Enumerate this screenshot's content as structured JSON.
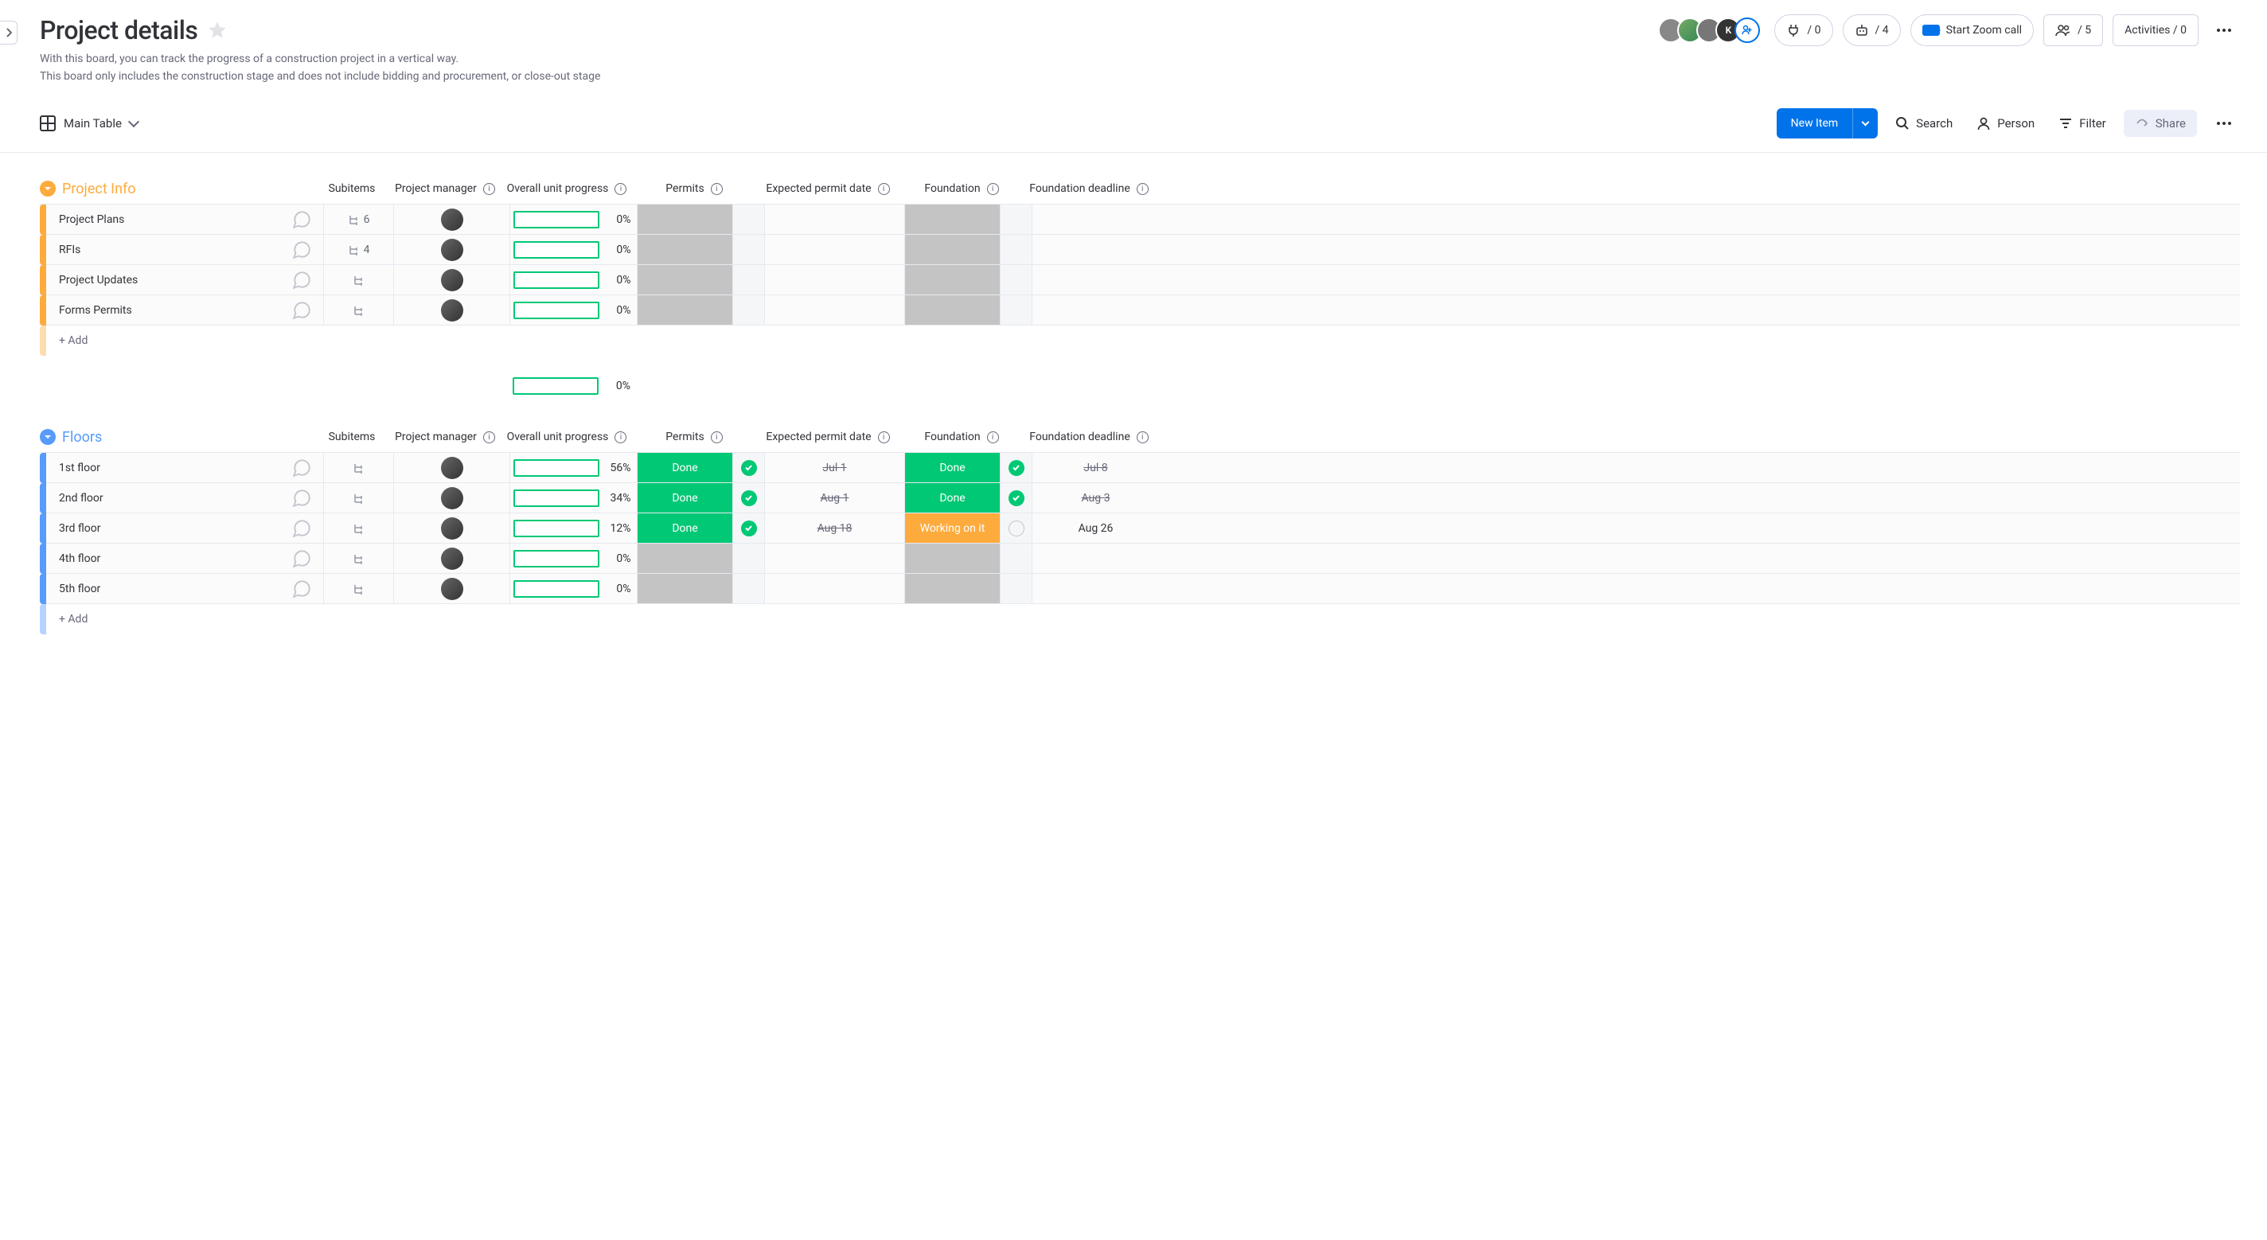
{
  "header": {
    "title": "Project details",
    "desc1": "With this board, you can track the progress of a construction project in a vertical way.",
    "desc2": "This board only includes the construction stage and does not include bidding and procurement, or close-out stage",
    "integrations_count": "/ 0",
    "automations_count": "/ 4",
    "zoom_label": "Start Zoom call",
    "members_count": "/ 5",
    "activities_label": "Activities / 0"
  },
  "toolbar": {
    "view_label": "Main Table",
    "new_item": "New Item",
    "search": "Search",
    "person": "Person",
    "filter": "Filter",
    "share": "Share"
  },
  "columns": {
    "subitems": "Subitems",
    "pm": "Project manager",
    "progress": "Overall unit progress",
    "permits": "Permits",
    "expected_permit": "Expected permit date",
    "foundation": "Foundation",
    "foundation_deadline": "Foundation deadline"
  },
  "groups": [
    {
      "name": "Project Info",
      "color": "orange",
      "rows": [
        {
          "name": "Project Plans",
          "sub": "6",
          "prog": 0,
          "permits": "",
          "edate": "",
          "edone": false,
          "found": "",
          "fdate": "",
          "fdone": false
        },
        {
          "name": "RFIs",
          "sub": "4",
          "prog": 0,
          "permits": "",
          "edate": "",
          "edone": false,
          "found": "",
          "fdate": "",
          "fdone": false
        },
        {
          "name": "Project Updates",
          "sub": "",
          "prog": 0,
          "permits": "",
          "edate": "",
          "edone": false,
          "found": "",
          "fdate": "",
          "fdone": false
        },
        {
          "name": "Forms Permits",
          "sub": "",
          "prog": 0,
          "permits": "",
          "edate": "",
          "edone": false,
          "found": "",
          "fdate": "",
          "fdone": false
        }
      ],
      "summary_prog": 0
    },
    {
      "name": "Floors",
      "color": "blue",
      "rows": [
        {
          "name": "1st floor",
          "sub": "",
          "prog": 56,
          "permits": "Done",
          "edate": "Jul 1",
          "edone": true,
          "found": "Done",
          "fdate": "Jul 8",
          "fdone": true
        },
        {
          "name": "2nd floor",
          "sub": "",
          "prog": 34,
          "permits": "Done",
          "edate": "Aug 1",
          "edone": true,
          "found": "Done",
          "fdate": "Aug 3",
          "fdone": true
        },
        {
          "name": "3rd floor",
          "sub": "",
          "prog": 12,
          "permits": "Done",
          "edate": "Aug 18",
          "edone": true,
          "found": "Working on it",
          "fdate": "Aug 26",
          "fdone": false,
          "fdate_strike": false
        },
        {
          "name": "4th floor",
          "sub": "",
          "prog": 0,
          "permits": "",
          "edate": "",
          "edone": false,
          "found": "",
          "fdate": "",
          "fdone": false
        },
        {
          "name": "5th floor",
          "sub": "",
          "prog": 0,
          "permits": "",
          "edate": "",
          "edone": false,
          "found": "",
          "fdate": "",
          "fdone": false
        }
      ]
    }
  ],
  "labels": {
    "add": "+ Add"
  }
}
